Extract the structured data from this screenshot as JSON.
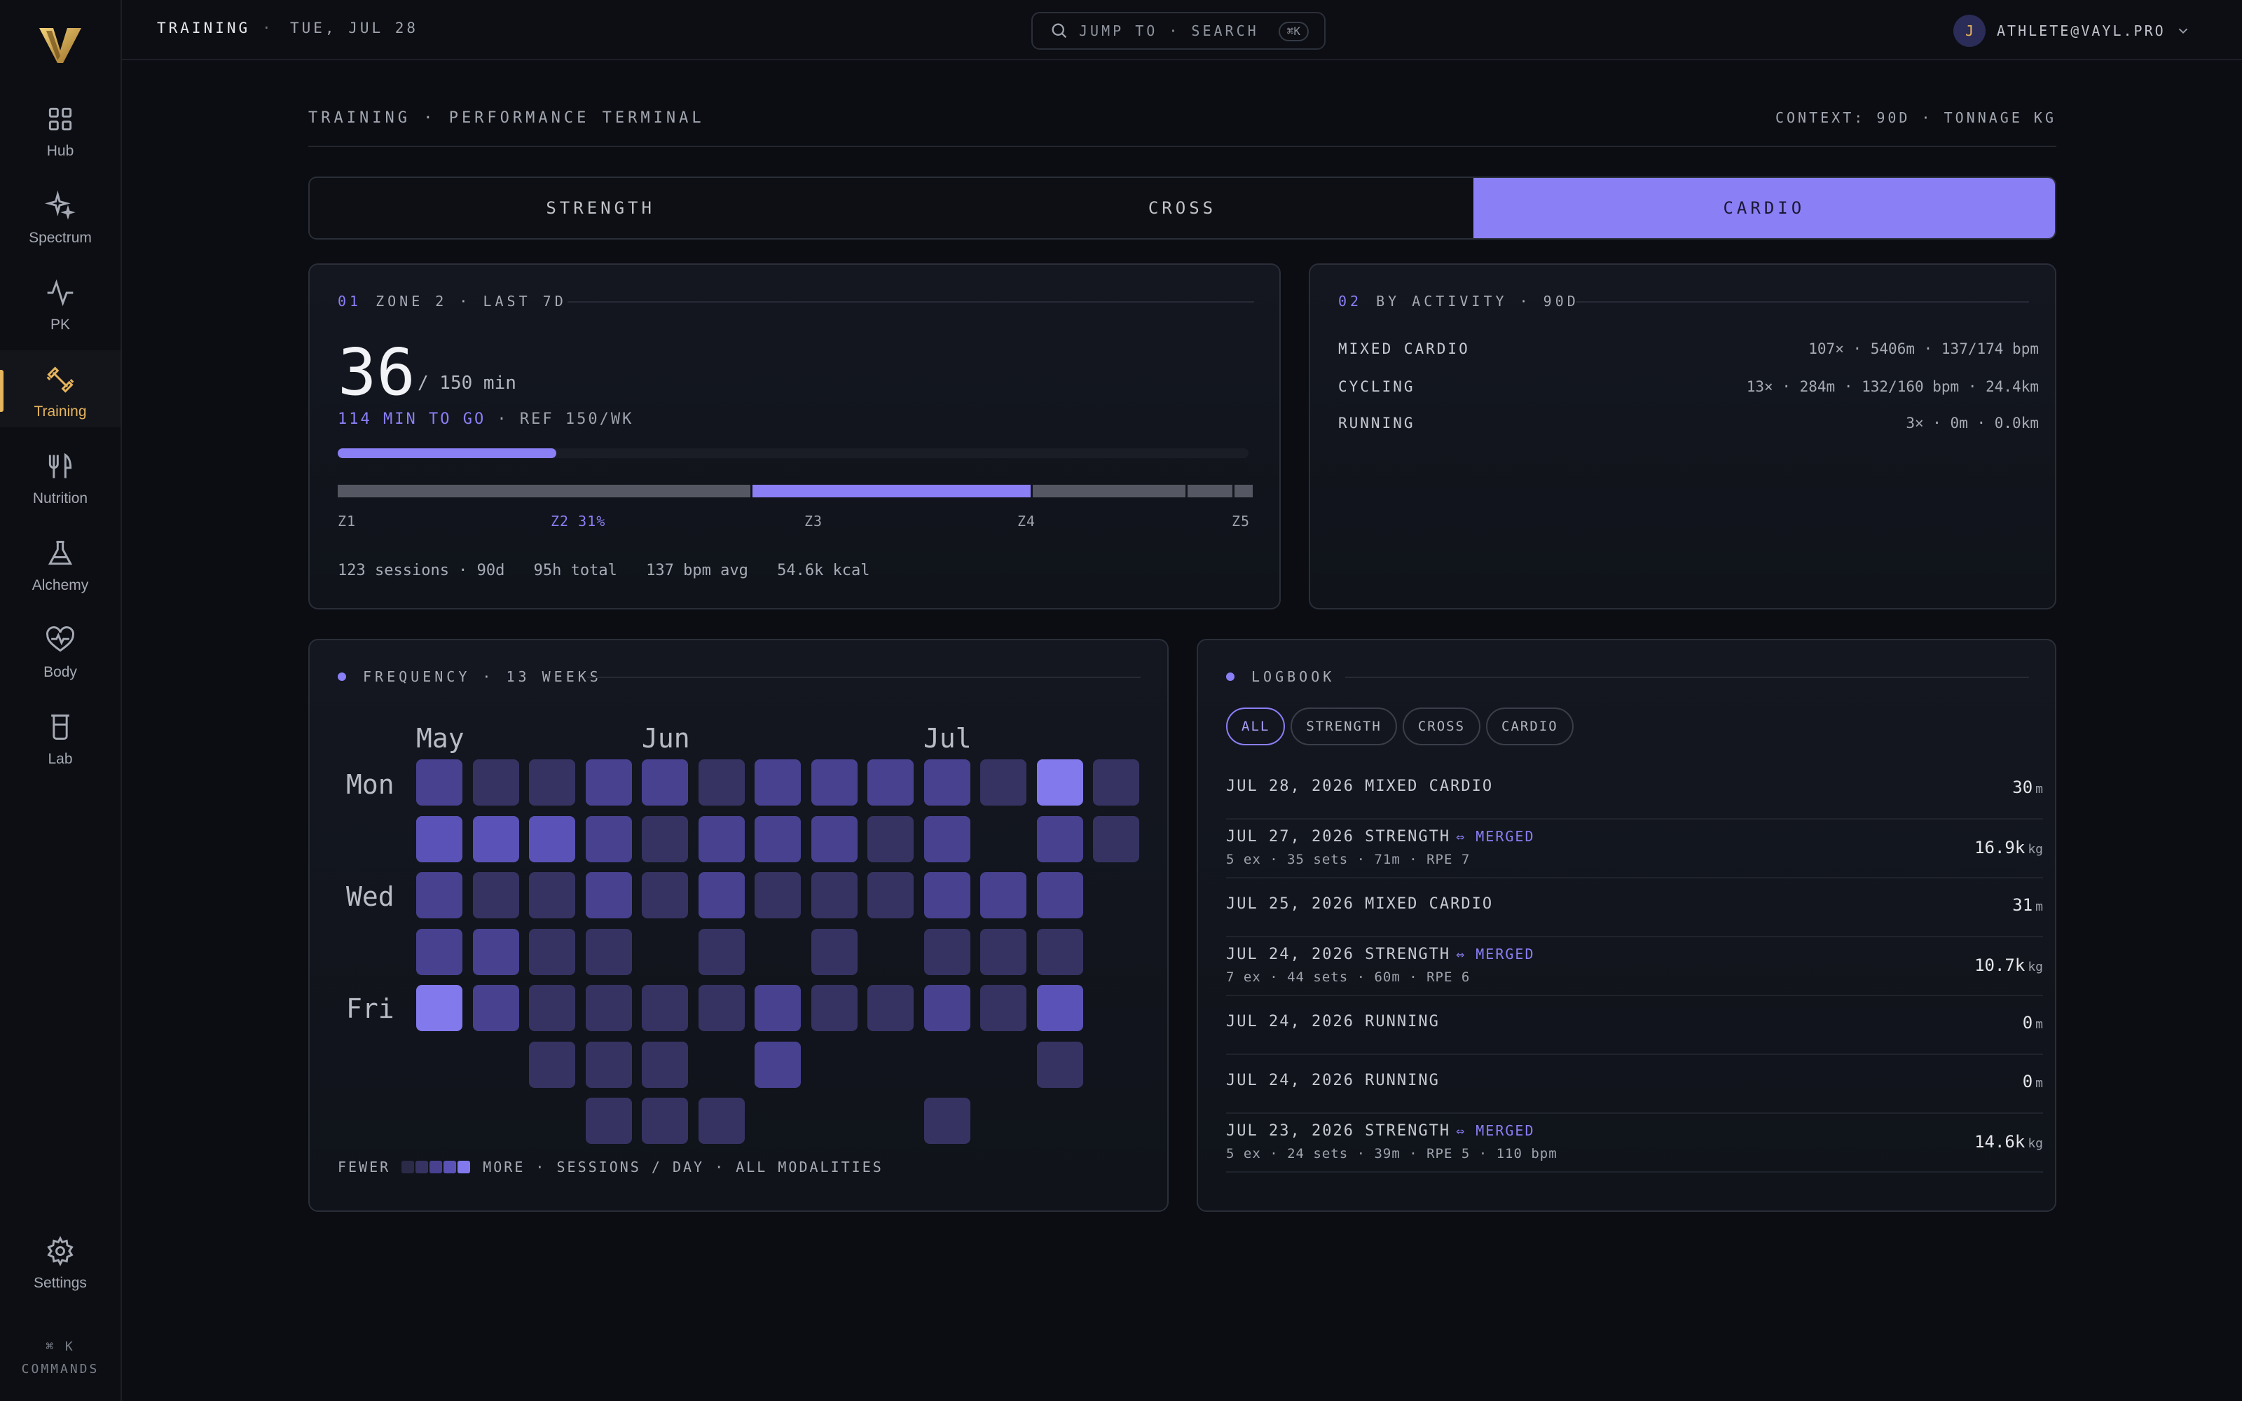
{
  "sidebar": {
    "items": [
      {
        "label": "Hub",
        "icon": "grid-icon"
      },
      {
        "label": "Spectrum",
        "icon": "sparkles-icon"
      },
      {
        "label": "PK",
        "icon": "activity-icon"
      },
      {
        "label": "Training",
        "icon": "dumbbell-icon",
        "active": true
      },
      {
        "label": "Nutrition",
        "icon": "utensils-icon"
      },
      {
        "label": "Alchemy",
        "icon": "flask-icon"
      },
      {
        "label": "Body",
        "icon": "heart-pulse-icon"
      },
      {
        "label": "Lab",
        "icon": "beaker-icon"
      }
    ],
    "settings_label": "Settings",
    "cmd_key": "⌘ K",
    "cmd_label": "COMMANDS"
  },
  "topbar": {
    "title": "TRAINING",
    "separator": "·",
    "date": "TUE, JUL 28",
    "search_placeholder": "JUMP TO · SEARCH",
    "search_kbd": "⌘K",
    "user_initial": "J",
    "user_email": "ATHLETE@VAYL.PRO"
  },
  "page": {
    "title": "TRAINING · PERFORMANCE TERMINAL",
    "context": "CONTEXT: 90D · TONNAGE KG"
  },
  "tabs": [
    {
      "label": "STRENGTH",
      "active": false
    },
    {
      "label": "CROSS",
      "active": false
    },
    {
      "label": "CARDIO",
      "active": true
    }
  ],
  "zone_card": {
    "num": "01",
    "title": "ZONE 2 · LAST 7D",
    "value": "36",
    "target": "/ 150 min",
    "to_go": "114 MIN TO GO",
    "ref": " · REF 150/WK",
    "progress_fraction": 0.24,
    "zone_shares": [
      0.46,
      0.31,
      0.17,
      0.05,
      0.02
    ],
    "zone_labels": [
      "Z1",
      "Z2 31%",
      "Z3",
      "Z4",
      "Z5"
    ],
    "stats": [
      "123 sessions · 90d",
      "95h total",
      "137 bpm avg",
      "54.6k kcal"
    ]
  },
  "activity_card": {
    "num": "02",
    "title": "BY ACTIVITY · 90D",
    "rows": [
      {
        "name": "MIXED CARDIO",
        "value": "107× · 5406m · 137/174 bpm"
      },
      {
        "name": "CYCLING",
        "value": "13× · 284m · 132/160 bpm · 24.4km"
      },
      {
        "name": "RUNNING",
        "value": "3× · 0m · 0.0km"
      }
    ]
  },
  "frequency_card": {
    "title": "FREQUENCY · 13 WEEKS",
    "months": [
      "May",
      "Jun",
      "Jul"
    ],
    "days": [
      "Mon",
      "Wed",
      "Fri"
    ],
    "levels": [
      [
        3,
        2,
        2,
        3,
        3,
        2,
        3,
        3,
        3,
        3,
        2,
        5,
        2
      ],
      [
        4,
        4,
        4,
        3,
        2,
        3,
        3,
        3,
        2,
        3,
        0,
        3,
        2
      ],
      [
        3,
        2,
        2,
        3,
        2,
        3,
        2,
        2,
        2,
        3,
        3,
        3,
        0
      ],
      [
        3,
        3,
        2,
        2,
        0,
        2,
        0,
        2,
        0,
        2,
        2,
        2,
        0
      ],
      [
        5,
        3,
        2,
        2,
        2,
        2,
        3,
        2,
        2,
        3,
        2,
        4,
        0
      ],
      [
        0,
        0,
        2,
        2,
        2,
        0,
        3,
        0,
        0,
        0,
        0,
        2,
        0
      ],
      [
        0,
        0,
        0,
        2,
        2,
        2,
        0,
        0,
        0,
        2,
        0,
        0,
        0
      ]
    ],
    "legend_fewer": "FEWER",
    "legend_more": "MORE · SESSIONS / DAY · ALL MODALITIES",
    "colors": [
      "#1b1d2b",
      "#2b2a47",
      "#363363",
      "#474190",
      "#5a52b6",
      "#8279ec"
    ]
  },
  "logbook": {
    "title": "LOGBOOK",
    "filters": [
      {
        "label": "ALL",
        "active": true
      },
      {
        "label": "STRENGTH",
        "active": false
      },
      {
        "label": "CROSS",
        "active": false
      },
      {
        "label": "CARDIO",
        "active": false
      }
    ],
    "entries": [
      {
        "title": "JUL 28, 2026 MIXED CARDIO",
        "merged": "",
        "sub": "",
        "value": "30",
        "unit": "m"
      },
      {
        "title": "JUL 27, 2026 STRENGTH",
        "merged": "⇔ MERGED",
        "sub": "5 ex · 35 sets · 71m · RPE 7",
        "value": "16.9k",
        "unit": "kg"
      },
      {
        "title": "JUL 25, 2026 MIXED CARDIO",
        "merged": "",
        "sub": "",
        "value": "31",
        "unit": "m"
      },
      {
        "title": "JUL 24, 2026 STRENGTH",
        "merged": "⇔ MERGED",
        "sub": "7 ex · 44 sets · 60m · RPE 6",
        "value": "10.7k",
        "unit": "kg"
      },
      {
        "title": "JUL 24, 2026 RUNNING",
        "merged": "",
        "sub": "",
        "value": "0",
        "unit": "m"
      },
      {
        "title": "JUL 24, 2026 RUNNING",
        "merged": "",
        "sub": "",
        "value": "0",
        "unit": "m"
      },
      {
        "title": "JUL 23, 2026 STRENGTH",
        "merged": "⇔ MERGED",
        "sub": "5 ex · 24 sets · 39m · RPE 5 · 110 bpm",
        "value": "14.6k",
        "unit": "kg"
      }
    ]
  },
  "colors": {
    "accent": "#8a7ff5",
    "gold": "#e6b45c",
    "bg": "#0b0d12"
  }
}
